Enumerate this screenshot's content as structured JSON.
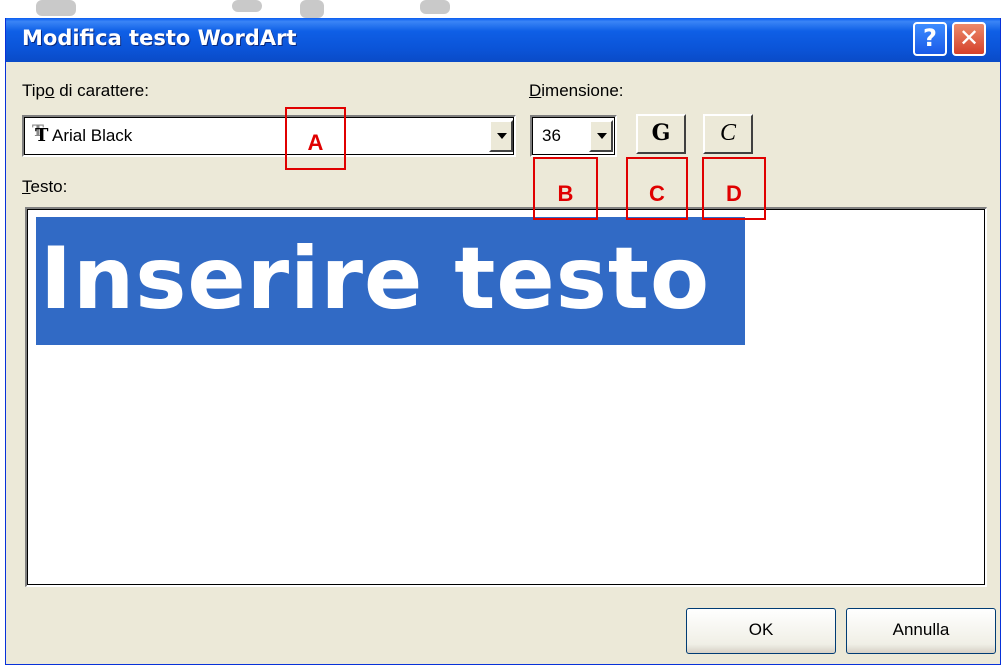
{
  "window": {
    "title": "Modifica testo WordArt"
  },
  "titlebar_buttons": {
    "help": "?",
    "close": "✕"
  },
  "font": {
    "label_before": "Tip",
    "label_accel": "o",
    "label_after": " di carattere:",
    "value": "Arial Black"
  },
  "size": {
    "label_accel": "D",
    "label_after": "imensione:",
    "value": "36"
  },
  "style_buttons": {
    "bold": "G",
    "italic": "C"
  },
  "text": {
    "label_accel": "T",
    "label_after": "esto:",
    "value": "Inserire testo"
  },
  "footer": {
    "ok": "OK",
    "cancel": "Annulla"
  },
  "annotations": [
    "A",
    "B",
    "C",
    "D"
  ],
  "colors": {
    "titlebar": "#0a54d8",
    "selection": "#316ac5",
    "annotation": "#e00000"
  }
}
